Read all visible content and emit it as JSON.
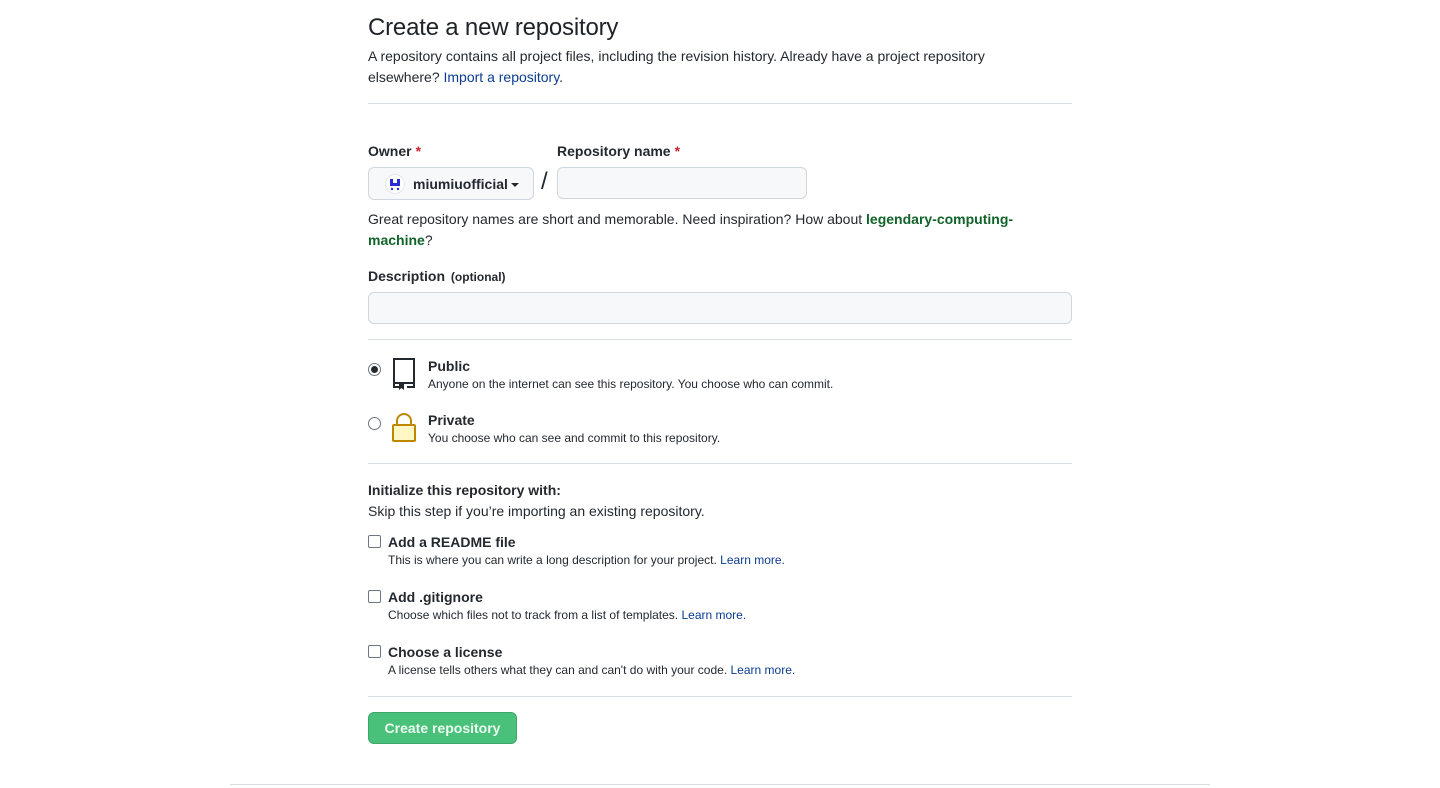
{
  "header": {
    "title": "Create a new repository",
    "subtitle": "A repository contains all project files, including the revision history. Already have a project repository elsewhere?",
    "import_link": "Import a repository",
    "period": "."
  },
  "owner": {
    "label": "Owner",
    "required_mark": "*",
    "selected": "miumiuofficial"
  },
  "repo_name": {
    "label": "Repository name",
    "required_mark": "*",
    "value": "",
    "slash": "/"
  },
  "hint": {
    "text": "Great repository names are short and memorable. Need inspiration? How about",
    "suggestion": "legendary-computing-machine",
    "end": "?"
  },
  "description": {
    "label": "Description",
    "optional": "(optional)",
    "value": ""
  },
  "visibility": {
    "public": {
      "title": "Public",
      "desc": "Anyone on the internet can see this repository. You choose who can commit.",
      "checked": true
    },
    "private": {
      "title": "Private",
      "desc": "You choose who can see and commit to this repository.",
      "checked": false
    }
  },
  "init": {
    "title": "Initialize this repository with:",
    "subtitle": "Skip this step if you’re importing an existing repository.",
    "readme": {
      "title": "Add a README file",
      "desc": "This is where you can write a long description for your project.",
      "learn": "Learn more."
    },
    "gitignore": {
      "title": "Add .gitignore",
      "desc": "Choose which files not to track from a list of templates.",
      "learn": "Learn more."
    },
    "license": {
      "title": "Choose a license",
      "desc": "A license tells others what they can and can't do with your code.",
      "learn": "Learn more."
    }
  },
  "submit": {
    "label": "Create repository"
  },
  "colors": {
    "accent_link": "#0a3d91",
    "suggestion": "#116329",
    "required": "#cf222e",
    "button_green": "#4ac17a",
    "lock_icon": "#bf8700"
  }
}
